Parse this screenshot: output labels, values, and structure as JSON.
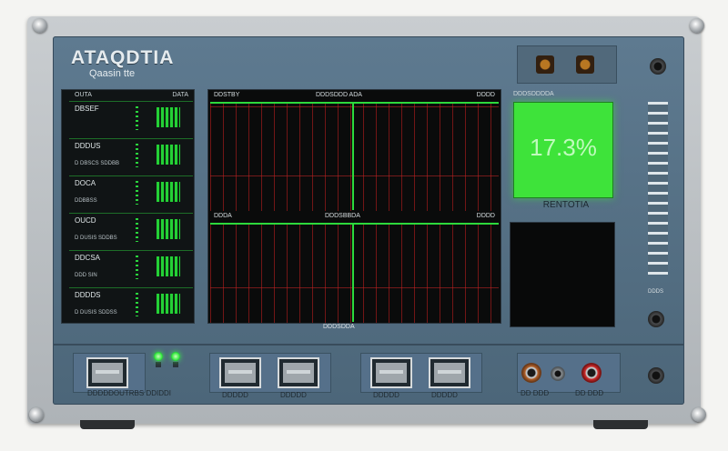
{
  "device": {
    "brand_title": "ATAQDTIA",
    "brand_subtitle": "Qaasin tte"
  },
  "channel_readout": {
    "header_left": "OUTA",
    "header_right": "DATA",
    "channels": [
      {
        "name": "DBSEF",
        "sub": ""
      },
      {
        "name": "DDDUS",
        "sub": "D DBSCS SDDBB"
      },
      {
        "name": "DOCA",
        "sub": "DDBBSS"
      },
      {
        "name": "OUCD",
        "sub": "D DUSIS SDDBS"
      },
      {
        "name": "DDCSA",
        "sub": "DDD SIN"
      },
      {
        "name": "DDDDS",
        "sub": "D DUSIS SDDSS"
      }
    ]
  },
  "oscilloscope": {
    "top_left": "DDSTBY",
    "top_center": "DDDSDDD ADA",
    "top_right": "DDDD",
    "mid_left": "DDDA",
    "mid_center": "DDDSBBDA",
    "mid_right": "DDDD",
    "footer": "DDDSDDA"
  },
  "status_display": {
    "label": "DDDSDDDDA",
    "value": "17.3%",
    "caption": "RENTOTIA"
  },
  "vent_caption": "DDDS",
  "ports": {
    "group1_label": "DDDDDOUTRBS DDIDDI",
    "group2_labels": [
      "DDDDD",
      "DDDDD"
    ],
    "group3_labels": [
      "DDDDD",
      "DDDDD"
    ],
    "av_labels": [
      "DD DDD",
      "DD DDD"
    ]
  },
  "colors": {
    "panel": "#56718a",
    "display_green": "#3ee33a",
    "trace_green": "#2dd93c",
    "grid_red": "#c81e1e"
  }
}
